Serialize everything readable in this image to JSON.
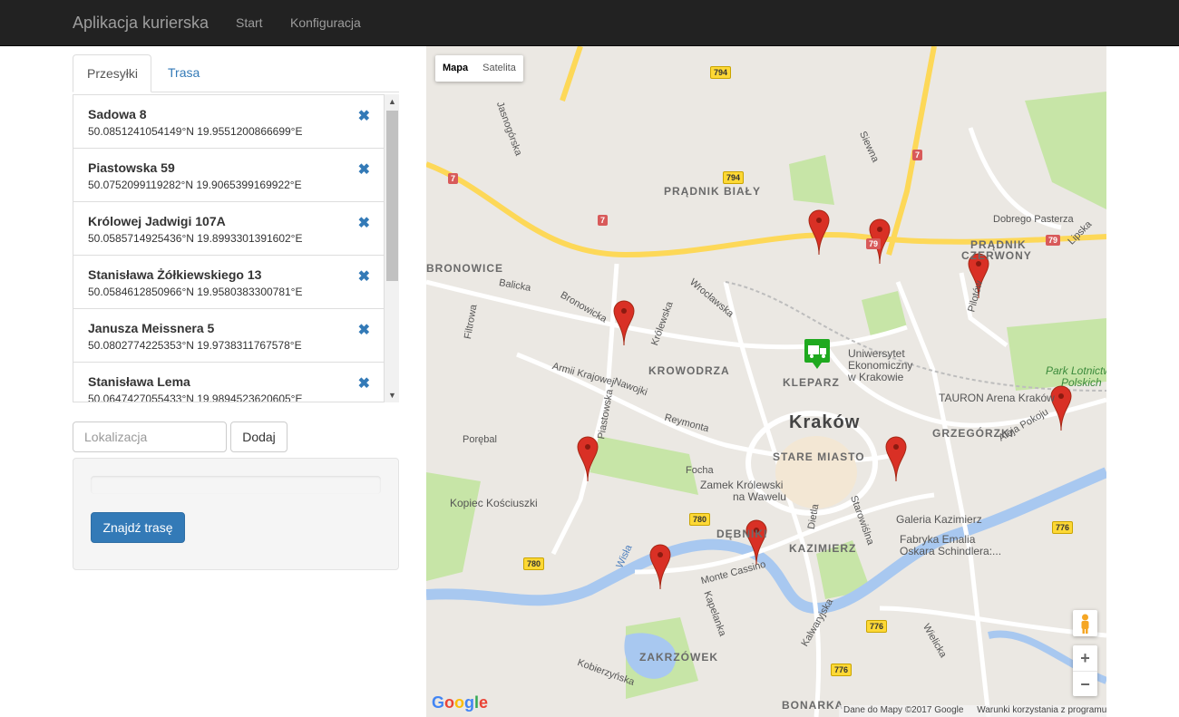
{
  "navbar": {
    "brand": "Aplikacja kurierska",
    "links": [
      "Start",
      "Konfiguracja"
    ]
  },
  "tabs": [
    "Przesyłki",
    "Trasa"
  ],
  "deliveries": [
    {
      "name": "Sadowa 8",
      "coords": "50.0851241054149°N 19.9551200866699°E"
    },
    {
      "name": "Piastowska 59",
      "coords": "50.0752099119282°N 19.9065399169922°E"
    },
    {
      "name": "Królowej Jadwigi 107A",
      "coords": "50.0585714925436°N 19.8993301391602°E"
    },
    {
      "name": "Stanisława Żółkiewskiego 13",
      "coords": "50.0584612850966°N 19.9580383300781°E"
    },
    {
      "name": "Janusza Meissnera 5",
      "coords": "50.0802774225353°N 19.9738311767578°E"
    },
    {
      "name": "Stanisława Lema",
      "coords": "50.0647427055433°N 19.9894523620605°E"
    }
  ],
  "remove_icon": "✖",
  "location_input": {
    "placeholder": "Lokalizacja",
    "value": ""
  },
  "add_button": "Dodaj",
  "find_route_button": "Znajdź trasę",
  "map": {
    "type_control": [
      "Mapa",
      "Satelita"
    ],
    "labels": {
      "city": "Kraków",
      "districts": [
        "PRĄDNIK BIAŁY",
        "PRĄDNIK",
        "CZERWONY",
        "KROWODRZA",
        "KLEPARZ",
        "STARE MIASTO",
        "GRZEGÓRZKI",
        "KAZIMIERZ",
        "DĘBNIKI",
        "ZAKRZÓWEK",
        "BONARKA",
        "BRONOWICE"
      ],
      "pois": [
        "Uniwersytet",
        "Ekonomiczny",
        "w Krakowie",
        "TAURON Arena Kraków",
        "Park Lotnictwa",
        "Polskich",
        "Zamek Królewski",
        "na Wawelu",
        "Kopiec Kościuszki",
        "Galeria Kazimierz",
        "Fabryka Emalia",
        "Oskara Schindlera:..."
      ],
      "streets": [
        "Armii Krajowej",
        "Wrocławska",
        "Królewska",
        "Reymonta",
        "Piastowska",
        "Bronowicka",
        "Focha",
        "Monte Cassino",
        "Jasnogórska",
        "Pilotów",
        "Aleja Pokoju",
        "Nawojki",
        "Kapelanka",
        "Balicka",
        "Filtrowa",
        "Porębal",
        "Dobrego Pasterza",
        "Wielicka",
        "Kalwaryjska",
        "Dietla",
        "Starowiślna",
        "Wisła",
        "Lipska",
        "Siewna",
        "Kobierzyńska"
      ],
      "road_numbers": [
        "794",
        "794",
        "7",
        "7",
        "7",
        "79",
        "79",
        "780",
        "780",
        "776",
        "776",
        "776"
      ]
    },
    "controls": {
      "zoom_in": "+",
      "zoom_out": "−"
    },
    "logo": "Google",
    "attribution": [
      "Dane do Mapy ©2017 Google",
      "Warunki korzystania z programu"
    ],
    "colors": {
      "marker": "#d93025",
      "start_marker": "#1fa91f",
      "river": "#a8c8f0",
      "major_road": "#fdd858",
      "park": "#c7e5a7"
    }
  }
}
